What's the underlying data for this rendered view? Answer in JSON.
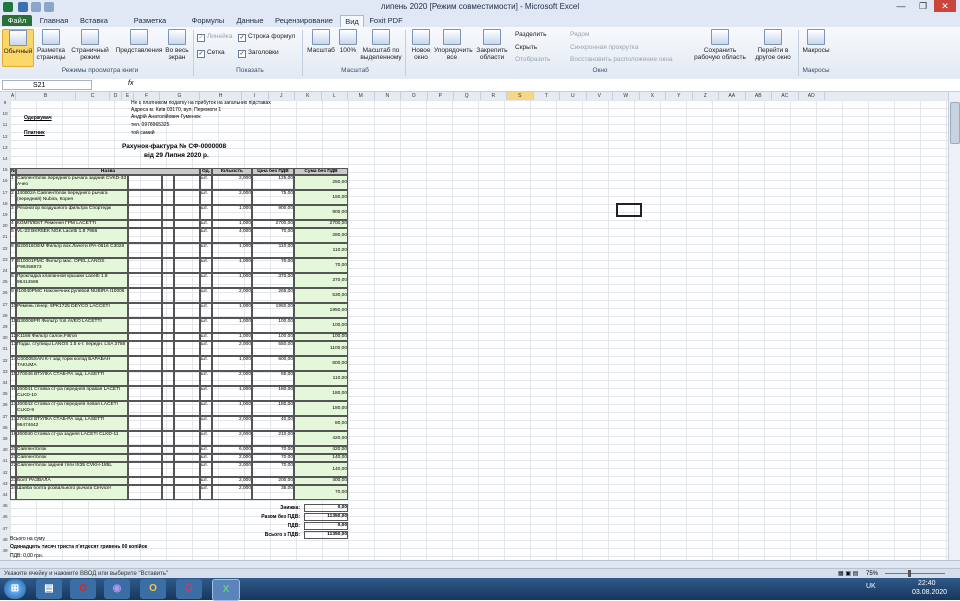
{
  "window": {
    "title": "липень 2020  [Режим совместимости] - Microsoft Excel",
    "controls": [
      "—",
      "❐",
      "✕"
    ]
  },
  "ribbon_tabs": [
    "Файл",
    "Главная",
    "Вставка",
    "Разметка страницы",
    "Формулы",
    "Данные",
    "Рецензирование",
    "Вид",
    "Foxit PDF"
  ],
  "ribbon": {
    "views": [
      "Обычный",
      "Разметка страницы",
      "Страничный режим",
      "Представления",
      "Во весь экран"
    ],
    "views_group": "Режимы просмотра книги",
    "show": [
      "Линейка",
      "Строка формул",
      "Сетка",
      "Заголовки"
    ],
    "show_group": "Показать",
    "zoom": [
      "Масштаб",
      "100%",
      "Масштаб по выделенному"
    ],
    "zoom_group": "Масштаб",
    "window": [
      "Новое окно",
      "Упорядочить все",
      "Закрепить области"
    ],
    "window_small": [
      "Разделить",
      "Скрыть",
      "Отобразить",
      "Рядом",
      "Синхронная прокрутка",
      "Восстановить расположение окна"
    ],
    "window_big": [
      "Сохранить рабочую область",
      "Перейти в другое окно"
    ],
    "window_group": "Окно",
    "macros": "Макросы",
    "macros_group": "Макросы"
  },
  "formula_bar": {
    "namebox": "S21",
    "fx": "fx",
    "value": ""
  },
  "columns": [
    "A",
    "B",
    "C",
    "D",
    "E",
    "F",
    "G",
    "H",
    "I",
    "J",
    "K",
    "L",
    "M",
    "N",
    "O",
    "P",
    "Q",
    "R",
    "S",
    "T",
    "U",
    "V",
    "W",
    "X",
    "Y",
    "Z",
    "AA",
    "AB",
    "AC",
    "AD"
  ],
  "row_numbers": [
    "9",
    "10",
    "11",
    "12",
    "13",
    "14",
    "15",
    "16",
    "17",
    "18",
    "19",
    "20",
    "21",
    "22",
    "23",
    "24",
    "25",
    "26",
    "27",
    "28",
    "29",
    "30",
    "31",
    "32",
    "33",
    "34",
    "35",
    "36",
    "37",
    "38",
    "39",
    "40",
    "41",
    "42",
    "43",
    "44",
    "45",
    "46",
    "47",
    "48",
    "49"
  ],
  "header_info": {
    "line1": "Не є платником податку на прибуток на загальних підставах",
    "line2": "Адреса м. Київ 03170, вул. Перемоги 1",
    "receiver_label": "Одержувач",
    "receiver": "Андрій Анатолійович Гуменюк",
    "phone": "тел. 0978965325",
    "payer_label": "Платник",
    "payer": "той самий"
  },
  "invoice": {
    "title": "Рахунок-фактура № СФ-0000008",
    "date": "від 29 Липня 2020 р.",
    "headers": [
      "№",
      "Назва",
      "Од.",
      "Кількість",
      "Ціна без ПДВ",
      "Сума без ПДВ"
    ],
    "rows": [
      {
        "n": "1",
        "name": "Сайлентблок переднего рычага задний CVKD-33 Ачео",
        "unit": "шт.",
        "qty": "2,000",
        "price": "125,00",
        "sum": "250,00"
      },
      {
        "n": "2",
        "name": "J40002A Сайлентблок переднего рычага (передний) Nubira, Корея",
        "unit": "шт.",
        "qty": "2,000",
        "price": "75,00",
        "sum": "150,00"
      },
      {
        "n": "3",
        "name": "Резонатор воздушного фильтра Спортедж",
        "unit": "шт.",
        "qty": "1,000",
        "price": "900,00",
        "sum": "900,00"
      },
      {
        "n": "4",
        "name": "КОМПЛЕКТ Ремення ГРМ LACETTI",
        "unit": "шт.",
        "qty": "1,000",
        "price": "2700,00",
        "sum": "2700,00"
      },
      {
        "n": "5",
        "name": "VL-23 BKR5EK NGK  Lacetti 1.8 7956",
        "unit": "шт.",
        "qty": "4,000",
        "price": "70,00",
        "sum": "280,00"
      },
      {
        "n": "6",
        "name": "B20016OEM Фильтр вох.Лачети IPA-0616 C3028",
        "unit": "шт.",
        "qty": "1,000",
        "price": "110,00",
        "sum": "110,00"
      },
      {
        "n": "7",
        "name": "B10001PMC Фильтр мас. OPEL,LANOS P96458873",
        "unit": "шт.",
        "qty": "1,000",
        "price": "70,00",
        "sum": "70,00"
      },
      {
        "n": "8",
        "name": "Прокладка клапанной крышки Lacetti 1.8  96414596",
        "unit": "шт.",
        "qty": "1,000",
        "price": "370,00",
        "sum": "370,00"
      },
      {
        "n": "9",
        "name": "I10040PMC Наконечник рулевой NUBIRA I10006",
        "unit": "шт.",
        "qty": "2,000",
        "price": "265,00",
        "sum": "530,00"
      },
      {
        "n": "10",
        "name": "Ремень генер. 6PK1725  DEYCO LACCETI",
        "unit": "шт.",
        "qty": "1,000",
        "price": "1950,00",
        "sum": "1950,00"
      },
      {
        "n": "11",
        "name": "B30008PR Фильтр топ.AVEO LACETTI",
        "unit": "шт.",
        "qty": "1,000",
        "price": "100,00",
        "sum": "100,00"
      },
      {
        "n": "12",
        "name": "K1166 Фильтр салон.Filtron",
        "unit": "шт.",
        "qty": "1,000",
        "price": "100,00",
        "sum": "100,00"
      },
      {
        "n": "13",
        "name": "Подш. ступицы LANOS 1.5 к-т. передн. LSA  3788",
        "unit": "шт.",
        "qty": "2,000",
        "price": "550,00",
        "sum": "1100,00"
      },
      {
        "n": "14",
        "name": "C00005SAN К-т зад торм колод БАРАБАН  TAKUMA",
        "unit": "шт.",
        "qty": "1,000",
        "price": "600,00",
        "sum": "600,00"
      },
      {
        "n": "15",
        "name": "J70046 ВТУЛКА СТАБ-РА зад. LASETTI",
        "unit": "шт.",
        "qty": "2,000",
        "price": "55,00",
        "sum": "110,00"
      },
      {
        "n": "16",
        "name": "J60041 Стойка ст-ра передняя правая LACETI CLKD-10",
        "unit": "шт.",
        "qty": "1,000",
        "price": "180,00",
        "sum": "180,00"
      },
      {
        "n": "17",
        "name": "J60042 Стойка ст-ра передняя левая LACETI CLKD-9",
        "unit": "шт.",
        "qty": "1,000",
        "price": "180,00",
        "sum": "180,00"
      },
      {
        "n": "17",
        "name": "J70042 ВТУЛКА СТАБ-РА зад. LASETTI 96474642",
        "unit": "шт.",
        "qty": "2,000",
        "price": "40,00",
        "sum": "80,00"
      },
      {
        "n": "18",
        "name": "J60040 Стойка ст-ра задняя LACETI CLKD-11",
        "unit": "шт.",
        "qty": "2,000",
        "price": "210,00",
        "sum": "420,00"
      },
      {
        "n": "20",
        "name": "Сайлентблок",
        "unit": "шт.",
        "qty": "6,000",
        "price": "70,00",
        "sum": "420,00"
      },
      {
        "n": "21",
        "name": "Сайлентблок",
        "unit": "шт.",
        "qty": "2,000",
        "price": "70,00",
        "sum": "140,00"
      },
      {
        "n": "22",
        "name": "Сайлентблок задней тяги IX35  CVKH-185L",
        "unit": "шт.",
        "qty": "2,000",
        "price": "70,00",
        "sum": "140,00"
      },
      {
        "n": "23",
        "name": "Болт РАЗВАЛА",
        "unit": "шт.",
        "qty": "2,000",
        "price": "200,00",
        "sum": "400,00"
      },
      {
        "n": "24",
        "name": "Шайба болта розвального рычага Cervice!",
        "unit": "шт.",
        "qty": "2,000",
        "price": "35,00",
        "sum": "70,00"
      }
    ],
    "totals": [
      {
        "label": "Знижка:",
        "value": "0,00"
      },
      {
        "label": "Разом без ПДВ:",
        "value": "11350,00"
      },
      {
        "label": "ПДВ:",
        "value": "0,00"
      },
      {
        "label": "Всього з ПДВ:",
        "value": "11350,00"
      }
    ],
    "sum_label": "Всього на суму",
    "sum_words": "Одинадцять тисяч триста п'ятдесят гривень 00 копійок",
    "vat_line": "ПДВ:        0,00 грн."
  },
  "status": {
    "message": "Укажите ячейку и нажмите ВВОД или выберите \"Вставить\"",
    "zoom": "75%"
  },
  "taskbar": {
    "lang": "UK",
    "time": "22:40",
    "date": "03.08.2020"
  },
  "colors": {
    "file_tab": "#2a6f38",
    "green_cell": "#e4f7d8",
    "header_gray": "#c9c9c9",
    "taskbar": "#1f4470"
  }
}
